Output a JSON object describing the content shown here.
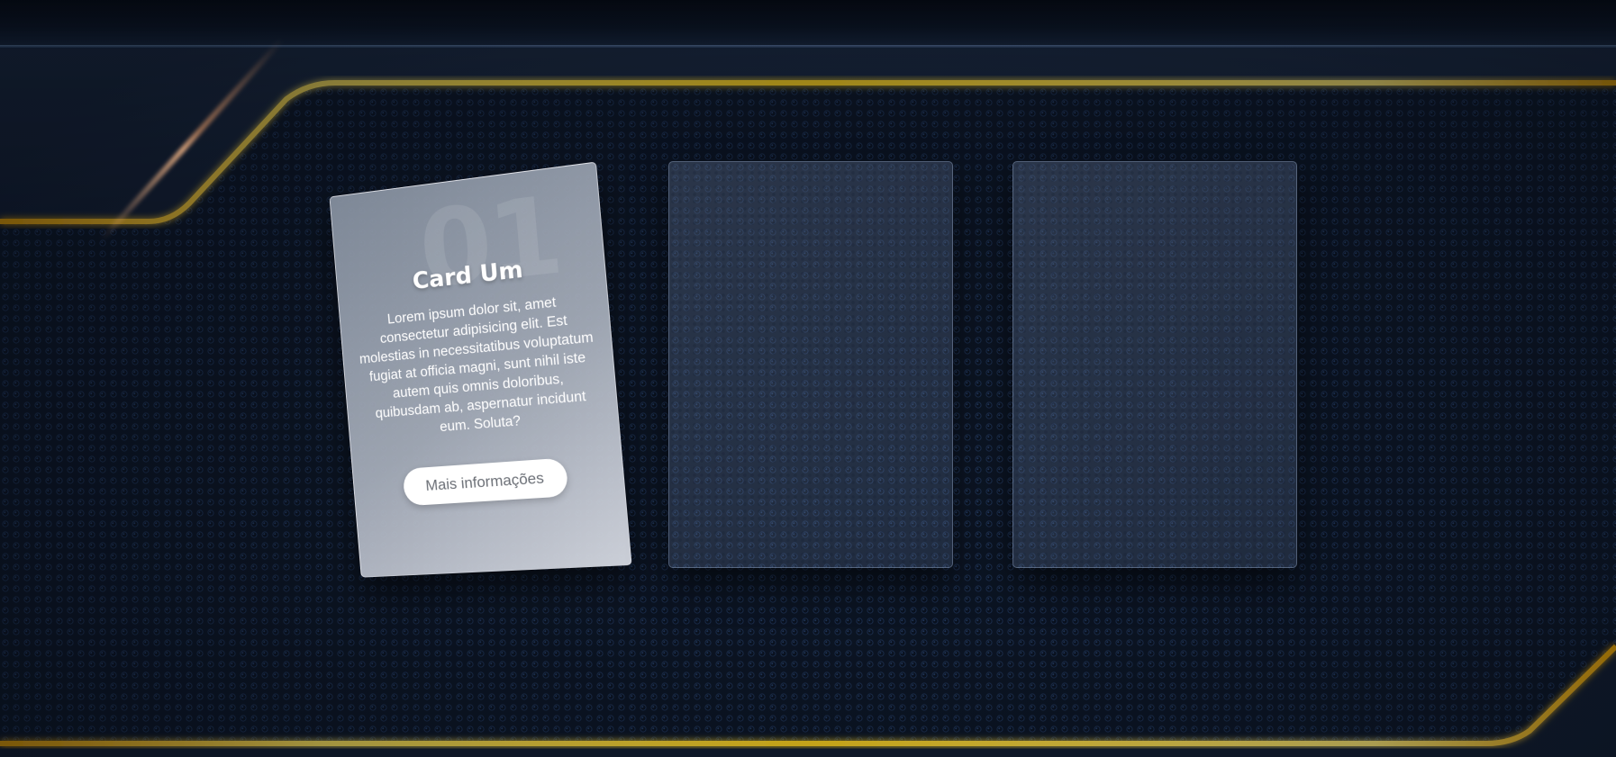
{
  "cards": [
    {
      "number": "01",
      "title": "Card Um",
      "body": "Lorem ipsum dolor sit, amet consectetur adipisicing elit. Est molestias in necessitatibus voluptatum fugiat at officia magni, sunt nihil iste autem quis omnis doloribus, quibusdam ab, aspernatur incidunt eum. Soluta?",
      "button_label": "Mais informações"
    },
    {
      "title": "",
      "body": ""
    },
    {
      "title": "",
      "body": ""
    }
  ],
  "colors": {
    "accent_gold": "#ffcc00",
    "background": "#121d2f",
    "mesh": "#2b4a78"
  }
}
